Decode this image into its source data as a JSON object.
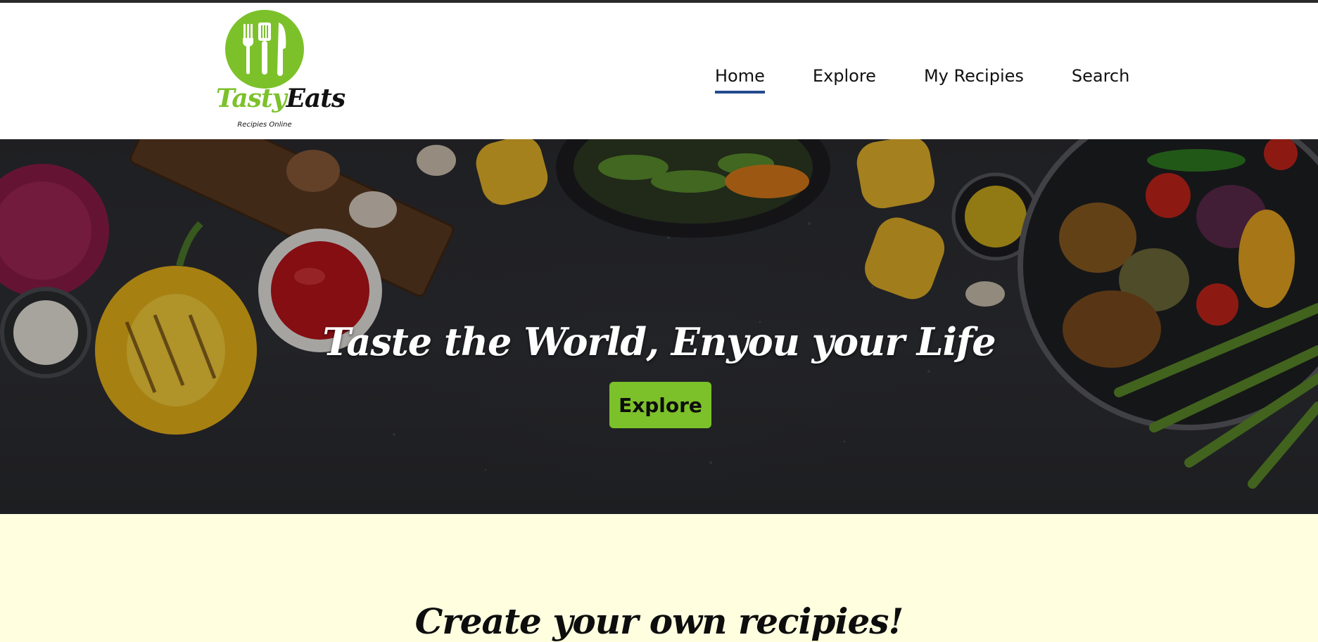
{
  "brand": {
    "name_part1": "Tasty",
    "name_part2": "Eats",
    "tagline": "Recipies Online",
    "icon": "fork-spatula-knife-icon",
    "accent_color": "#7cc12a"
  },
  "nav": {
    "items": [
      {
        "label": "Home",
        "active": true
      },
      {
        "label": "Explore",
        "active": false
      },
      {
        "label": "My Recipies",
        "active": false
      },
      {
        "label": "Search",
        "active": false
      }
    ],
    "active_underline_color": "#234a8e"
  },
  "hero": {
    "title": "Taste the World, Enyou your Life",
    "button_label": "Explore",
    "button_color": "#7cc12a"
  },
  "section": {
    "heading": "Create your own recipies!",
    "background_color": "#ffffe0"
  }
}
